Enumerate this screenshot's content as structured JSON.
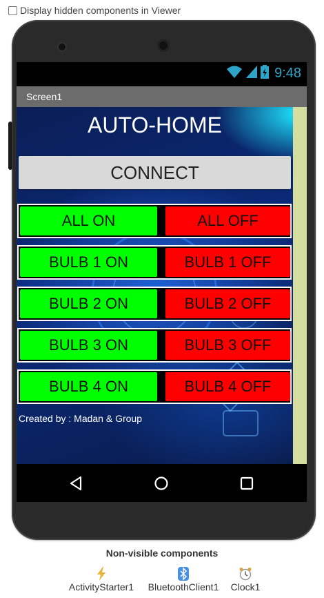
{
  "viewer_option": {
    "label": "Display hidden components in Viewer",
    "checked": false
  },
  "status_bar": {
    "time": "9:48"
  },
  "screen": {
    "title": "Screen1"
  },
  "app": {
    "title": "AUTO-HOME",
    "connect_label": "CONNECT",
    "rows": [
      {
        "on_label": "ALL ON",
        "off_label": "ALL OFF"
      },
      {
        "on_label": "BULB 1 ON",
        "off_label": "BULB 1 OFF"
      },
      {
        "on_label": "BULB 2 ON",
        "off_label": "BULB 2 OFF"
      },
      {
        "on_label": "BULB 3 ON",
        "off_label": "BULB 3 OFF"
      },
      {
        "on_label": "BULB 4 ON",
        "off_label": "BULB 4 OFF"
      }
    ],
    "credit": "Created by : Madan & Group",
    "colors": {
      "on": "#00ff00",
      "off": "#ff0000",
      "connect": "#d9d9d9"
    }
  },
  "nav_icons": [
    "back-icon",
    "home-icon",
    "recents-icon"
  ],
  "non_visible": {
    "title": "Non-visible components",
    "items": [
      {
        "label": "ActivityStarter1",
        "icon": "lightning-icon"
      },
      {
        "label": "BluetoothClient1",
        "icon": "bluetooth-icon"
      },
      {
        "label": "Clock1",
        "icon": "clock-icon"
      }
    ]
  }
}
